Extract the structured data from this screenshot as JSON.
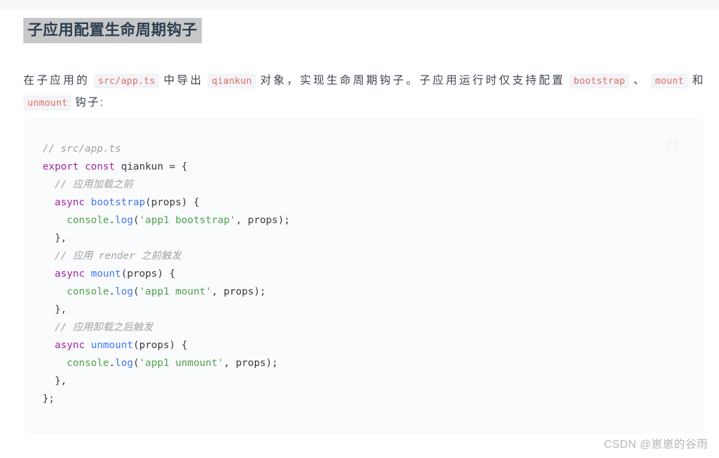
{
  "page": {
    "heading": "子应用配置生命周期钩子",
    "heading_highlight_color": "#c8c8c8",
    "background": "#ffffff",
    "top_strip_color": "#f7f8fa"
  },
  "paragraph": {
    "seg1": "在子应用的",
    "code1": "src/app.ts",
    "seg2": "中导出",
    "code2": "qiankun",
    "seg3": "对象，实现生命周期钩子。子应用运行时仅支持配置",
    "code3": "bootstrap",
    "seg4": "、",
    "code4": "mount",
    "seg5": "和",
    "code5": "unmount",
    "seg6": "钩子:",
    "chip_text_color": "#e06c63",
    "chip_bg_color": "#f3f4f8"
  },
  "code_block": {
    "background": "#fafbfc",
    "copy_icon": "copy-icon",
    "language": "typescript",
    "lines": [
      {
        "indent": 0,
        "tokens": [
          {
            "t": "comment",
            "v": "// src/app.ts"
          }
        ]
      },
      {
        "indent": 0,
        "tokens": [
          {
            "t": "kw",
            "v": "export"
          },
          {
            "t": "plain",
            "v": " "
          },
          {
            "t": "kw",
            "v": "const"
          },
          {
            "t": "plain",
            "v": " qiankun = {"
          }
        ]
      },
      {
        "indent": 1,
        "tokens": [
          {
            "t": "comment",
            "v": "// 应用加载之前"
          }
        ]
      },
      {
        "indent": 1,
        "tokens": [
          {
            "t": "kw",
            "v": "async"
          },
          {
            "t": "plain",
            "v": " "
          },
          {
            "t": "fn",
            "v": "bootstrap"
          },
          {
            "t": "plain",
            "v": "(props) {"
          }
        ]
      },
      {
        "indent": 2,
        "tokens": [
          {
            "t": "built",
            "v": "console"
          },
          {
            "t": "plain",
            "v": "."
          },
          {
            "t": "fn",
            "v": "log"
          },
          {
            "t": "plain",
            "v": "("
          },
          {
            "t": "str",
            "v": "'app1 bootstrap'"
          },
          {
            "t": "plain",
            "v": ", props);"
          }
        ]
      },
      {
        "indent": 1,
        "tokens": [
          {
            "t": "plain",
            "v": "},"
          }
        ]
      },
      {
        "indent": 1,
        "tokens": [
          {
            "t": "comment",
            "v": "// 应用 render 之前触发"
          }
        ]
      },
      {
        "indent": 1,
        "tokens": [
          {
            "t": "kw",
            "v": "async"
          },
          {
            "t": "plain",
            "v": " "
          },
          {
            "t": "fn",
            "v": "mount"
          },
          {
            "t": "plain",
            "v": "(props) {"
          }
        ]
      },
      {
        "indent": 2,
        "tokens": [
          {
            "t": "built",
            "v": "console"
          },
          {
            "t": "plain",
            "v": "."
          },
          {
            "t": "fn",
            "v": "log"
          },
          {
            "t": "plain",
            "v": "("
          },
          {
            "t": "str",
            "v": "'app1 mount'"
          },
          {
            "t": "plain",
            "v": ", props);"
          }
        ]
      },
      {
        "indent": 1,
        "tokens": [
          {
            "t": "plain",
            "v": "},"
          }
        ]
      },
      {
        "indent": 1,
        "tokens": [
          {
            "t": "comment",
            "v": "// 应用卸载之后触发"
          }
        ]
      },
      {
        "indent": 1,
        "tokens": [
          {
            "t": "kw",
            "v": "async"
          },
          {
            "t": "plain",
            "v": " "
          },
          {
            "t": "fn",
            "v": "unmount"
          },
          {
            "t": "plain",
            "v": "(props) {"
          }
        ]
      },
      {
        "indent": 2,
        "tokens": [
          {
            "t": "built",
            "v": "console"
          },
          {
            "t": "plain",
            "v": "."
          },
          {
            "t": "fn",
            "v": "log"
          },
          {
            "t": "plain",
            "v": "("
          },
          {
            "t": "str",
            "v": "'app1 unmount'"
          },
          {
            "t": "plain",
            "v": ", props);"
          }
        ]
      },
      {
        "indent": 1,
        "tokens": [
          {
            "t": "plain",
            "v": "},"
          }
        ]
      },
      {
        "indent": 0,
        "tokens": [
          {
            "t": "plain",
            "v": "};"
          }
        ]
      }
    ],
    "token_colors": {
      "comment": "#a0a1a7",
      "kw": "#a626a4",
      "fn": "#4078f2",
      "str": "#50a14f",
      "built": "#50a14f",
      "plain": "#383a42"
    }
  },
  "watermark": {
    "text": "CSDN @崽崽的谷雨",
    "color": "#b3b6bd"
  }
}
